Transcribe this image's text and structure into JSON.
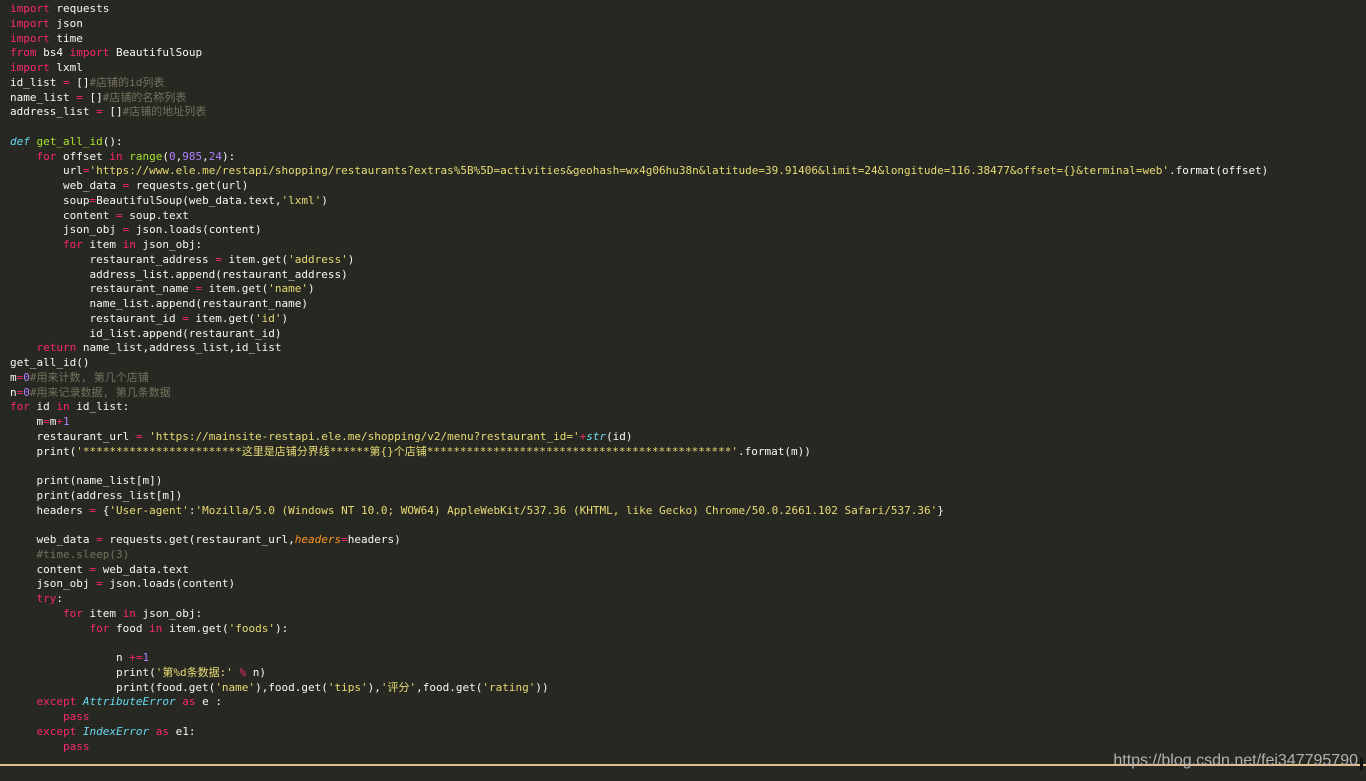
{
  "editor": {
    "theme_colors": {
      "background": "#272822",
      "text": "#f8f8f2",
      "keyword": "#f92672",
      "function": "#a6e22e",
      "string": "#e6db74",
      "number": "#ae81ff",
      "comment": "#75715e",
      "builtin": "#66d9ef",
      "parameter": "#fd971f"
    },
    "lines": [
      [
        {
          "t": "kw",
          "v": "import"
        },
        {
          "t": "pl",
          "v": " requests"
        }
      ],
      [
        {
          "t": "kw",
          "v": "import"
        },
        {
          "t": "pl",
          "v": " json"
        }
      ],
      [
        {
          "t": "kw",
          "v": "import"
        },
        {
          "t": "pl",
          "v": " time"
        }
      ],
      [
        {
          "t": "kw",
          "v": "from"
        },
        {
          "t": "pl",
          "v": " bs4 "
        },
        {
          "t": "kw",
          "v": "import"
        },
        {
          "t": "pl",
          "v": " BeautifulSoup"
        }
      ],
      [
        {
          "t": "kw",
          "v": "import"
        },
        {
          "t": "pl",
          "v": " lxml"
        }
      ],
      [
        {
          "t": "pl",
          "v": "id_list "
        },
        {
          "t": "kw",
          "v": "="
        },
        {
          "t": "pl",
          "v": " []"
        },
        {
          "t": "cmt",
          "v": "#店铺的id列表"
        }
      ],
      [
        {
          "t": "pl",
          "v": "name_list "
        },
        {
          "t": "kw",
          "v": "="
        },
        {
          "t": "pl",
          "v": " []"
        },
        {
          "t": "cmt",
          "v": "#店铺的名称列表"
        }
      ],
      [
        {
          "t": "pl",
          "v": "address_list "
        },
        {
          "t": "kw",
          "v": "="
        },
        {
          "t": "pl",
          "v": " []"
        },
        {
          "t": "cmt",
          "v": "#店铺的地址列表"
        }
      ],
      [],
      [
        {
          "t": "def",
          "v": "def"
        },
        {
          "t": "pl",
          "v": " "
        },
        {
          "t": "fn",
          "v": "get_all_id"
        },
        {
          "t": "pl",
          "v": "():"
        }
      ],
      [
        {
          "t": "pl",
          "v": "    "
        },
        {
          "t": "kw",
          "v": "for"
        },
        {
          "t": "pl",
          "v": " offset "
        },
        {
          "t": "kw",
          "v": "in"
        },
        {
          "t": "pl",
          "v": " "
        },
        {
          "t": "fn",
          "v": "range"
        },
        {
          "t": "pl",
          "v": "("
        },
        {
          "t": "num",
          "v": "0"
        },
        {
          "t": "pl",
          "v": ","
        },
        {
          "t": "num",
          "v": "985"
        },
        {
          "t": "pl",
          "v": ","
        },
        {
          "t": "num",
          "v": "24"
        },
        {
          "t": "pl",
          "v": "):"
        }
      ],
      [
        {
          "t": "pl",
          "v": "        url"
        },
        {
          "t": "kw",
          "v": "="
        },
        {
          "t": "str",
          "v": "'https://www.ele.me/restapi/shopping/restaurants?extras%5B%5D=activities&geohash=wx4g06hu38n&latitude=39.91406&limit=24&longitude=116.38477&offset={}&terminal=web'"
        },
        {
          "t": "pl",
          "v": ".format(offset)"
        }
      ],
      [
        {
          "t": "pl",
          "v": "        web_data "
        },
        {
          "t": "kw",
          "v": "="
        },
        {
          "t": "pl",
          "v": " requests.get(url)"
        }
      ],
      [
        {
          "t": "pl",
          "v": "        soup"
        },
        {
          "t": "kw",
          "v": "="
        },
        {
          "t": "pl",
          "v": "BeautifulSoup(web_data.text,"
        },
        {
          "t": "str",
          "v": "'lxml'"
        },
        {
          "t": "pl",
          "v": ")"
        }
      ],
      [
        {
          "t": "pl",
          "v": "        content "
        },
        {
          "t": "kw",
          "v": "="
        },
        {
          "t": "pl",
          "v": " soup.text"
        }
      ],
      [
        {
          "t": "pl",
          "v": "        json_obj "
        },
        {
          "t": "kw",
          "v": "="
        },
        {
          "t": "pl",
          "v": " json.loads(content)"
        }
      ],
      [
        {
          "t": "pl",
          "v": "        "
        },
        {
          "t": "kw",
          "v": "for"
        },
        {
          "t": "pl",
          "v": " item "
        },
        {
          "t": "kw",
          "v": "in"
        },
        {
          "t": "pl",
          "v": " json_obj:"
        }
      ],
      [
        {
          "t": "pl",
          "v": "            restaurant_address "
        },
        {
          "t": "kw",
          "v": "="
        },
        {
          "t": "pl",
          "v": " item.get("
        },
        {
          "t": "str",
          "v": "'address'"
        },
        {
          "t": "pl",
          "v": ")"
        }
      ],
      [
        {
          "t": "pl",
          "v": "            address_list.append(restaurant_address)"
        }
      ],
      [
        {
          "t": "pl",
          "v": "            restaurant_name "
        },
        {
          "t": "kw",
          "v": "="
        },
        {
          "t": "pl",
          "v": " item.get("
        },
        {
          "t": "str",
          "v": "'name'"
        },
        {
          "t": "pl",
          "v": ")"
        }
      ],
      [
        {
          "t": "pl",
          "v": "            name_list.append(restaurant_name)"
        }
      ],
      [
        {
          "t": "pl",
          "v": "            restaurant_id "
        },
        {
          "t": "kw",
          "v": "="
        },
        {
          "t": "pl",
          "v": " item.get("
        },
        {
          "t": "str",
          "v": "'id'"
        },
        {
          "t": "pl",
          "v": ")"
        }
      ],
      [
        {
          "t": "pl",
          "v": "            id_list.append(restaurant_id)"
        }
      ],
      [
        {
          "t": "pl",
          "v": "    "
        },
        {
          "t": "kw",
          "v": "return"
        },
        {
          "t": "pl",
          "v": " name_list,address_list,id_list"
        }
      ],
      [
        {
          "t": "pl",
          "v": "get_all_id()"
        }
      ],
      [
        {
          "t": "pl",
          "v": "m"
        },
        {
          "t": "kw",
          "v": "="
        },
        {
          "t": "num",
          "v": "0"
        },
        {
          "t": "cmt",
          "v": "#用来计数, 第几个店铺"
        }
      ],
      [
        {
          "t": "pl",
          "v": "n"
        },
        {
          "t": "kw",
          "v": "="
        },
        {
          "t": "num",
          "v": "0"
        },
        {
          "t": "cmt",
          "v": "#用来记录数据, 第几条数据"
        }
      ],
      [
        {
          "t": "kw",
          "v": "for"
        },
        {
          "t": "pl",
          "v": " id "
        },
        {
          "t": "kw",
          "v": "in"
        },
        {
          "t": "pl",
          "v": " id_list:"
        }
      ],
      [
        {
          "t": "pl",
          "v": "    m"
        },
        {
          "t": "kw",
          "v": "="
        },
        {
          "t": "pl",
          "v": "m"
        },
        {
          "t": "kw",
          "v": "+"
        },
        {
          "t": "num",
          "v": "1"
        }
      ],
      [
        {
          "t": "pl",
          "v": "    restaurant_url "
        },
        {
          "t": "kw",
          "v": "="
        },
        {
          "t": "pl",
          "v": " "
        },
        {
          "t": "str",
          "v": "'https://mainsite-restapi.ele.me/shopping/v2/menu?restaurant_id='"
        },
        {
          "t": "kw",
          "v": "+"
        },
        {
          "t": "bi",
          "v": "str"
        },
        {
          "t": "pl",
          "v": "(id)"
        }
      ],
      [
        {
          "t": "pl",
          "v": "    print("
        },
        {
          "t": "str",
          "v": "'************************这里是店铺分界线******第{}个店铺**********************************************'"
        },
        {
          "t": "pl",
          "v": ".format(m))"
        }
      ],
      [],
      [
        {
          "t": "pl",
          "v": "    print(name_list[m])"
        }
      ],
      [
        {
          "t": "pl",
          "v": "    print(address_list[m])"
        }
      ],
      [
        {
          "t": "pl",
          "v": "    headers "
        },
        {
          "t": "kw",
          "v": "="
        },
        {
          "t": "pl",
          "v": " {"
        },
        {
          "t": "str",
          "v": "'User-agent'"
        },
        {
          "t": "pl",
          "v": ":"
        },
        {
          "t": "str",
          "v": "'Mozilla/5.0 (Windows NT 10.0; WOW64) AppleWebKit/537.36 (KHTML, like Gecko) Chrome/50.0.2661.102 Safari/537.36'"
        },
        {
          "t": "pl",
          "v": "}"
        }
      ],
      [],
      [
        {
          "t": "pl",
          "v": "    web_data "
        },
        {
          "t": "kw",
          "v": "="
        },
        {
          "t": "pl",
          "v": " requests.get(restaurant_url,"
        },
        {
          "t": "param",
          "v": "headers"
        },
        {
          "t": "kw",
          "v": "="
        },
        {
          "t": "pl",
          "v": "headers)"
        }
      ],
      [
        {
          "t": "pl",
          "v": "    "
        },
        {
          "t": "cmt",
          "v": "#time.sleep(3)"
        }
      ],
      [
        {
          "t": "pl",
          "v": "    content "
        },
        {
          "t": "kw",
          "v": "="
        },
        {
          "t": "pl",
          "v": " web_data.text"
        }
      ],
      [
        {
          "t": "pl",
          "v": "    json_obj "
        },
        {
          "t": "kw",
          "v": "="
        },
        {
          "t": "pl",
          "v": " json.loads(content)"
        }
      ],
      [
        {
          "t": "pl",
          "v": "    "
        },
        {
          "t": "kw",
          "v": "try"
        },
        {
          "t": "pl",
          "v": ":"
        }
      ],
      [
        {
          "t": "pl",
          "v": "        "
        },
        {
          "t": "kw",
          "v": "for"
        },
        {
          "t": "pl",
          "v": " item "
        },
        {
          "t": "kw",
          "v": "in"
        },
        {
          "t": "pl",
          "v": " json_obj:"
        }
      ],
      [
        {
          "t": "pl",
          "v": "            "
        },
        {
          "t": "kw",
          "v": "for"
        },
        {
          "t": "pl",
          "v": " food "
        },
        {
          "t": "kw",
          "v": "in"
        },
        {
          "t": "pl",
          "v": " item.get("
        },
        {
          "t": "str",
          "v": "'foods'"
        },
        {
          "t": "pl",
          "v": "):"
        }
      ],
      [],
      [
        {
          "t": "pl",
          "v": "                n "
        },
        {
          "t": "kw",
          "v": "+="
        },
        {
          "t": "num",
          "v": "1"
        }
      ],
      [
        {
          "t": "pl",
          "v": "                print("
        },
        {
          "t": "str",
          "v": "'第%d条数据:'"
        },
        {
          "t": "pl",
          "v": " "
        },
        {
          "t": "kw",
          "v": "%"
        },
        {
          "t": "pl",
          "v": " n)"
        }
      ],
      [
        {
          "t": "pl",
          "v": "                print(food.get("
        },
        {
          "t": "str",
          "v": "'name'"
        },
        {
          "t": "pl",
          "v": "),food.get("
        },
        {
          "t": "str",
          "v": "'tips'"
        },
        {
          "t": "pl",
          "v": "),"
        },
        {
          "t": "str",
          "v": "'评分'"
        },
        {
          "t": "pl",
          "v": ",food.get("
        },
        {
          "t": "str",
          "v": "'rating'"
        },
        {
          "t": "pl",
          "v": "))"
        }
      ],
      [
        {
          "t": "pl",
          "v": "    "
        },
        {
          "t": "kw",
          "v": "except"
        },
        {
          "t": "pl",
          "v": " "
        },
        {
          "t": "bi",
          "v": "AttributeError"
        },
        {
          "t": "pl",
          "v": " "
        },
        {
          "t": "kw",
          "v": "as"
        },
        {
          "t": "pl",
          "v": " e :"
        }
      ],
      [
        {
          "t": "pl",
          "v": "        "
        },
        {
          "t": "kw",
          "v": "pass"
        }
      ],
      [
        {
          "t": "pl",
          "v": "    "
        },
        {
          "t": "kw",
          "v": "except"
        },
        {
          "t": "pl",
          "v": " "
        },
        {
          "t": "bi",
          "v": "IndexError"
        },
        {
          "t": "pl",
          "v": " "
        },
        {
          "t": "kw",
          "v": "as"
        },
        {
          "t": "pl",
          "v": " e1:"
        }
      ],
      [
        {
          "t": "pl",
          "v": "        "
        },
        {
          "t": "kw",
          "v": "pass"
        }
      ]
    ]
  },
  "watermark": {
    "text": "https://blog.csdn.net/fei347795790"
  }
}
